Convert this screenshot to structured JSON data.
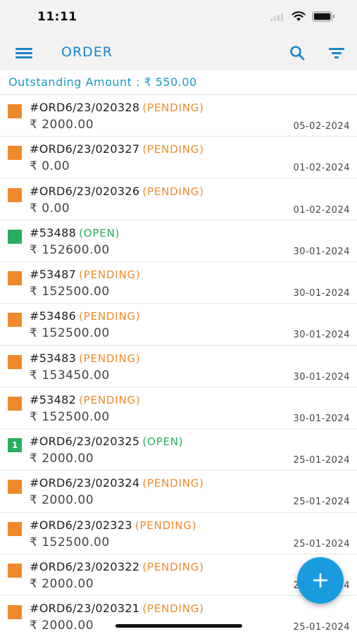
{
  "status_bar": {
    "time": "11:11"
  },
  "app_bar": {
    "title": "ORDER"
  },
  "outstanding": {
    "text": "Outstanding Amount : ₹ 550.00"
  },
  "colors": {
    "accent": "#1a86c9",
    "pending": "#ef8a2b",
    "open": "#27ae5f",
    "fab": "#1a9be0"
  },
  "orders": [
    {
      "number": "#ORD6/23/020328",
      "status": "(PENDING)",
      "status_type": "pending",
      "badge": "",
      "amount": "₹ 2000.00",
      "date": "05-02-2024"
    },
    {
      "number": "#ORD6/23/020327",
      "status": "(PENDING)",
      "status_type": "pending",
      "badge": "",
      "amount": "₹ 0.00",
      "date": "01-02-2024"
    },
    {
      "number": "#ORD6/23/020326",
      "status": "(PENDING)",
      "status_type": "pending",
      "badge": "",
      "amount": "₹ 0.00",
      "date": "01-02-2024"
    },
    {
      "number": "#53488",
      "status": "(OPEN)",
      "status_type": "open",
      "badge": "",
      "amount": "₹ 152600.00",
      "date": "30-01-2024"
    },
    {
      "number": "#53487",
      "status": "(PENDING)",
      "status_type": "pending",
      "badge": "",
      "amount": "₹ 152500.00",
      "date": "30-01-2024"
    },
    {
      "number": "#53486",
      "status": "(PENDING)",
      "status_type": "pending",
      "badge": "",
      "amount": "₹ 152500.00",
      "date": "30-01-2024"
    },
    {
      "number": "#53483",
      "status": "(PENDING)",
      "status_type": "pending",
      "badge": "",
      "amount": "₹ 153450.00",
      "date": "30-01-2024"
    },
    {
      "number": "#53482",
      "status": "(PENDING)",
      "status_type": "pending",
      "badge": "",
      "amount": "₹ 152500.00",
      "date": "30-01-2024"
    },
    {
      "number": "#ORD6/23/020325",
      "status": "(OPEN)",
      "status_type": "open",
      "badge": "1",
      "amount": "₹ 2000.00",
      "date": "25-01-2024"
    },
    {
      "number": "#ORD6/23/020324",
      "status": "(PENDING)",
      "status_type": "pending",
      "badge": "",
      "amount": "₹ 2000.00",
      "date": "25-01-2024"
    },
    {
      "number": "#ORD6/23/02323",
      "status": "(PENDING)",
      "status_type": "pending",
      "badge": "",
      "amount": "₹ 152500.00",
      "date": "25-01-2024"
    },
    {
      "number": "#ORD6/23/020322",
      "status": "(PENDING)",
      "status_type": "pending",
      "badge": "",
      "amount": "₹ 2000.00",
      "date": "25-01-2024"
    },
    {
      "number": "#ORD6/23/020321",
      "status": "(PENDING)",
      "status_type": "pending",
      "badge": "",
      "amount": "₹ 2000.00",
      "date": "25-01-2024"
    }
  ],
  "fab": {
    "label": "+"
  }
}
